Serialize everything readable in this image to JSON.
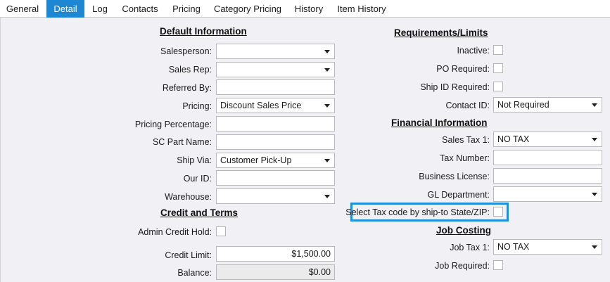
{
  "tabs": [
    "General",
    "Detail",
    "Log",
    "Contacts",
    "Pricing",
    "Category Pricing",
    "History",
    "Item History"
  ],
  "active_tab": "Detail",
  "default_information": {
    "title": "Default Information",
    "salesperson_label": "Salesperson:",
    "salesperson_value": "",
    "sales_rep_label": "Sales Rep:",
    "sales_rep_value": "",
    "referred_by_label": "Referred By:",
    "referred_by_value": "",
    "pricing_label": "Pricing:",
    "pricing_value": "Discount Sales Price",
    "pricing_percentage_label": "Pricing Percentage:",
    "pricing_percentage_value": "",
    "sc_part_name_label": "SC Part Name:",
    "sc_part_name_value": "",
    "ship_via_label": "Ship Via:",
    "ship_via_value": "Customer Pick-Up",
    "our_id_label": "Our ID:",
    "our_id_value": "",
    "warehouse_label": "Warehouse:",
    "warehouse_value": ""
  },
  "credit_and_terms": {
    "title": "Credit and Terms",
    "admin_credit_hold_label": "Admin Credit Hold:",
    "credit_limit_label": "Credit Limit:",
    "credit_limit_value": "$1,500.00",
    "balance_label": "Balance:",
    "balance_value": "$0.00"
  },
  "requirements_limits": {
    "title": "Requirements/Limits",
    "inactive_label": "Inactive:",
    "po_required_label": "PO Required:",
    "ship_id_required_label": "Ship ID Required:",
    "contact_id_label": "Contact ID:",
    "contact_id_value": "Not Required"
  },
  "financial_information": {
    "title": "Financial Information",
    "sales_tax_1_label": "Sales Tax 1:",
    "sales_tax_1_value": "NO TAX",
    "tax_number_label": "Tax Number:",
    "tax_number_value": "",
    "business_license_label": "Business License:",
    "business_license_value": "",
    "gl_department_label": "GL Department:",
    "gl_department_value": "",
    "select_tax_code_label": "Select Tax code by ship-to State/ZIP:"
  },
  "job_costing": {
    "title": "Job Costing",
    "job_tax_1_label": "Job Tax 1:",
    "job_tax_1_value": "NO TAX",
    "job_required_label": "Job Required:"
  },
  "colors": {
    "accent": "#1e87d3",
    "highlight": "#1e8fd8",
    "background": "#f1f0f5"
  }
}
